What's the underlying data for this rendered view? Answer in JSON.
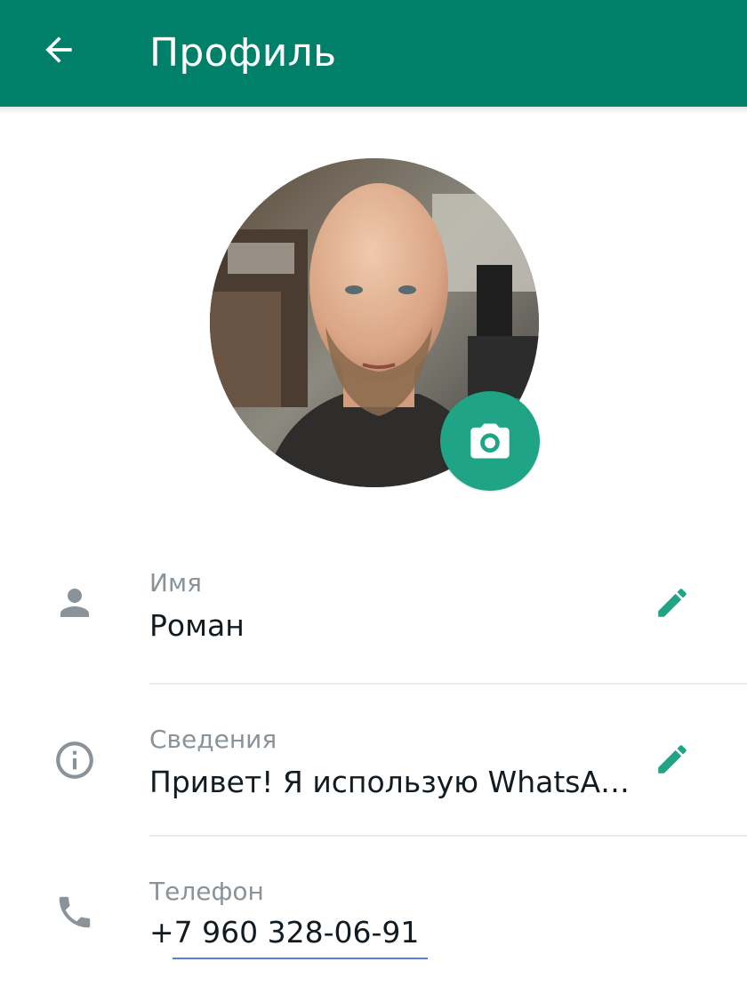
{
  "header": {
    "title": "Профиль",
    "back_icon": "arrow-left-icon",
    "background_color": "#008069"
  },
  "avatar": {
    "camera_icon": "camera-icon",
    "camera_button_color": "#1fa485"
  },
  "profile_rows": [
    {
      "label": "Имя",
      "value": "Роман",
      "icon": "person-icon",
      "editable": true
    },
    {
      "label": "Сведения",
      "value": "Привет! Я использую WhatsA…",
      "icon": "info-icon",
      "editable": true
    },
    {
      "label": "Телефон",
      "value": "+7 960 328-06-91",
      "icon": "phone-icon",
      "editable": false
    }
  ],
  "colors": {
    "accent": "#1fa485",
    "icon_gray": "#8a9399",
    "text_primary": "#111b21"
  }
}
